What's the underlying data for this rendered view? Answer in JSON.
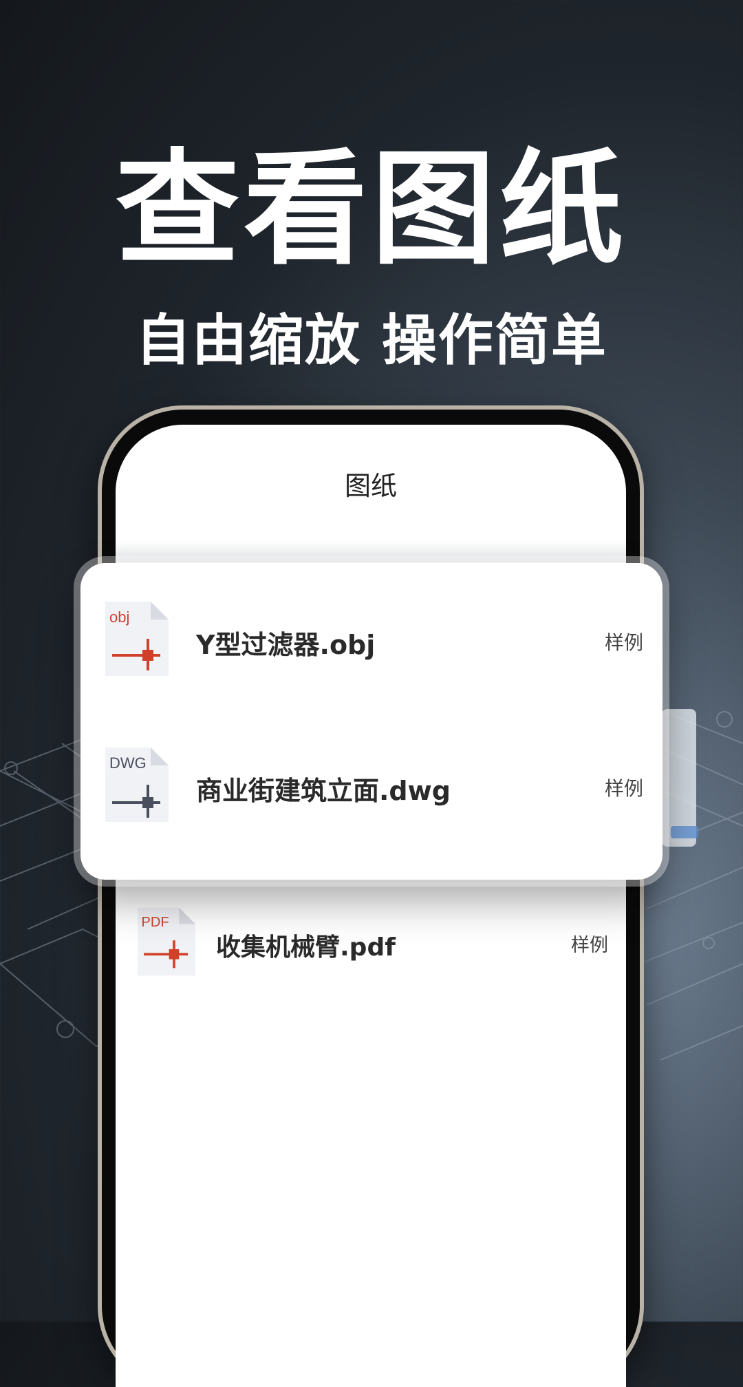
{
  "headline": "查看图纸",
  "subheadline": "自由缩放 操作简单",
  "screen": {
    "title": "图纸"
  },
  "files": [
    {
      "type_label": "obj",
      "name": "Y型过滤器.obj",
      "tag": "样例",
      "accent": "#d1412a"
    },
    {
      "type_label": "DWG",
      "name": "商业街建筑立面.dwg",
      "tag": "样例",
      "accent": "#4a4f5e"
    },
    {
      "type_label": "PDF",
      "name": "收集机械臂.pdf",
      "tag": "样例",
      "accent": "#d1412a"
    }
  ]
}
